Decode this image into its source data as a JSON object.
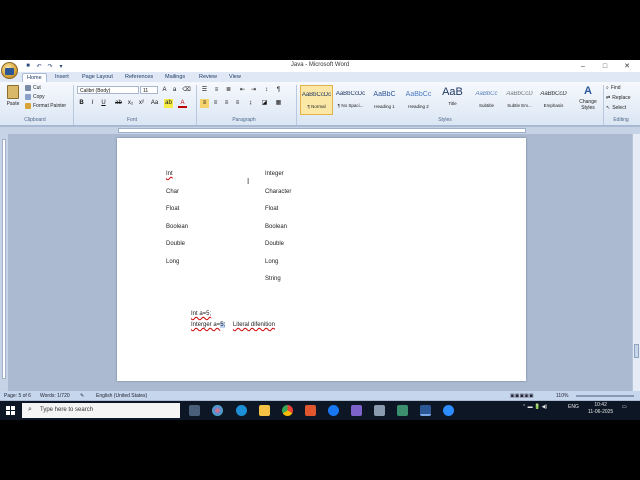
{
  "window": {
    "title": "Java - Microsoft Word",
    "controls": [
      "–",
      "□",
      "✕"
    ]
  },
  "ribbon": {
    "tabs": [
      "Home",
      "Insert",
      "Page Layout",
      "References",
      "Mailings",
      "Review",
      "View"
    ],
    "active_tab": "Home",
    "clipboard": {
      "paste": "Paste",
      "cut": "Cut",
      "copy": "Copy",
      "format_painter": "Format Painter",
      "label": "Clipboard"
    },
    "font": {
      "name": "Calibri (Body)",
      "size": "11",
      "label": "Font",
      "bold": "B",
      "italic": "I",
      "underline": "U"
    },
    "paragraph": {
      "label": "Paragraph"
    },
    "styles": {
      "label": "Styles",
      "items": [
        {
          "preview": "AaBbCcDc",
          "name": "¶ Normal"
        },
        {
          "preview": "AaBbCcDc",
          "name": "¶ No Spaci..."
        },
        {
          "preview": "AaBbC",
          "name": "Heading 1"
        },
        {
          "preview": "AaBbCc",
          "name": "Heading 2"
        },
        {
          "preview": "AaB",
          "name": "Title"
        },
        {
          "preview": "AaBbCc",
          "name": "Subtitle"
        },
        {
          "preview": "AaBbCcD",
          "name": "Subtle Em..."
        },
        {
          "preview": "AaBbCcD",
          "name": "Emphasis"
        }
      ],
      "change_styles": "Change Styles"
    },
    "editing": {
      "find": "Find",
      "replace": "Replace",
      "select": "Select",
      "label": "Editing"
    }
  },
  "document": {
    "left_column": [
      "Int",
      "Char",
      "Float",
      "Boolean",
      "Double",
      "Long"
    ],
    "right_column": [
      "Integer",
      "Character",
      "Float",
      "Boolean",
      "Double",
      "Long",
      "String"
    ],
    "code_line_1": "Int a=5;",
    "code_line_2_prefix": "Interger a=",
    "code_line_2_selected": "5;",
    "code_line_2_suffix": "Literal difenition"
  },
  "statusbar": {
    "page": "Page: 5 of 6",
    "words": "Words: 1/720",
    "language": "English (United States)",
    "zoom": "110%"
  },
  "taskbar": {
    "search_placeholder": "Type here to search",
    "time": "10:42",
    "date": "11-06-2025",
    "lang": "ENG"
  },
  "colors": {
    "accent": "#2b5797",
    "taskbar": "#0c1624",
    "selection": "#bcd3f2"
  }
}
